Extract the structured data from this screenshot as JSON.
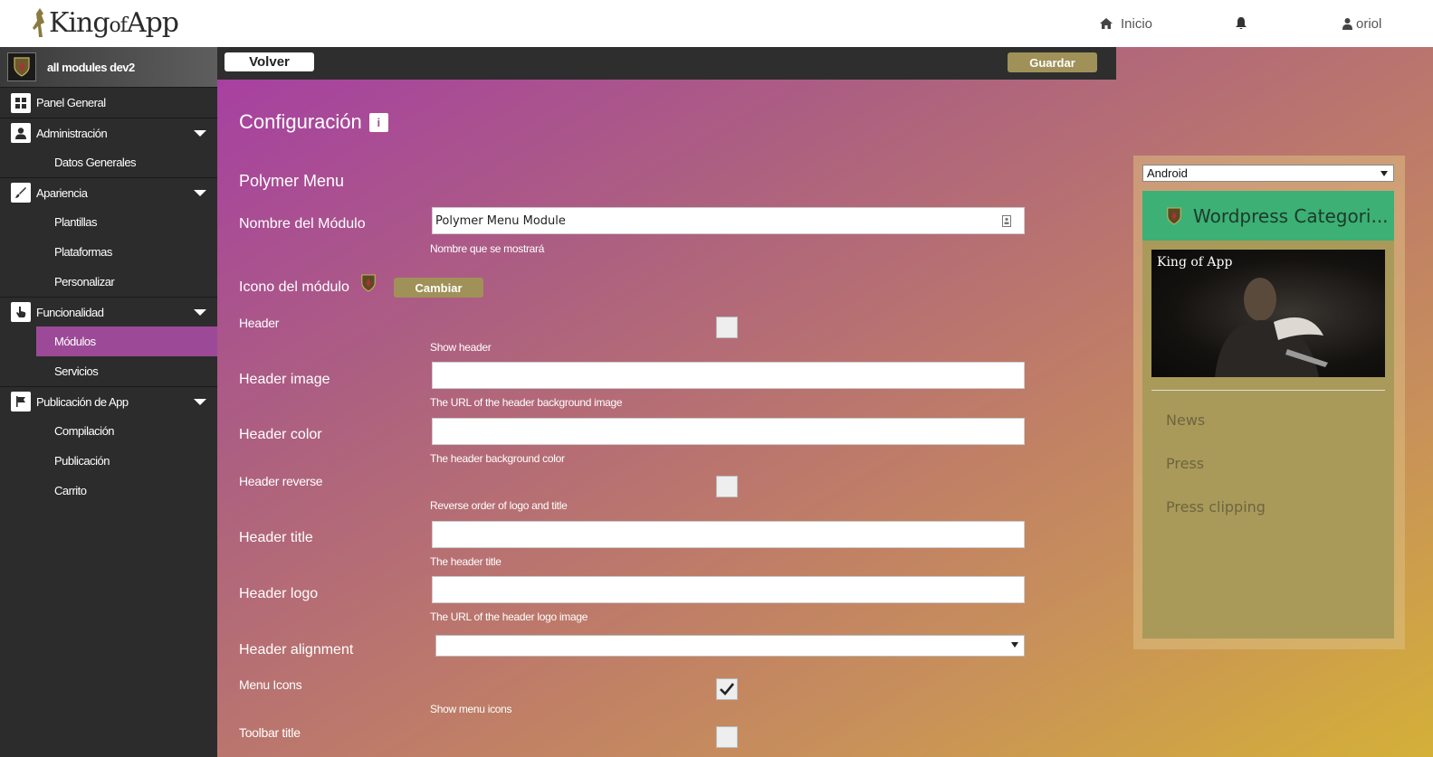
{
  "header": {
    "logo_text_1": "King",
    "logo_text_2": "of",
    "logo_text_3": "App",
    "home_label": "Inicio",
    "user_label": "oriol"
  },
  "sidebar": {
    "app_name": "all modules dev2",
    "items": [
      {
        "label": "Panel General"
      },
      {
        "label": "Administración"
      },
      {
        "label": "Datos Generales"
      },
      {
        "label": "Apariencia"
      },
      {
        "label": "Plantillas"
      },
      {
        "label": "Plataformas"
      },
      {
        "label": "Personalizar"
      },
      {
        "label": "Funcionalidad"
      },
      {
        "label": "Módulos"
      },
      {
        "label": "Servicios"
      },
      {
        "label": "Publicación de App"
      },
      {
        "label": "Compilación"
      },
      {
        "label": "Publicación"
      },
      {
        "label": "Carrito"
      }
    ]
  },
  "toolbar": {
    "back_label": "Volver",
    "save_label": "Guardar"
  },
  "config": {
    "title": "Configuración",
    "info_icon": "i",
    "module_title": "Polymer Menu",
    "name_label": "Nombre del Módulo",
    "name_value": "Polymer Menu Module",
    "name_help": "Nombre que se mostrará",
    "icon_label": "Icono del módulo",
    "change_label": "Cambiar",
    "fields": {
      "header_label": "Header",
      "header_help": "Show header",
      "header_checked": false,
      "header_image_label": "Header image",
      "header_image_value": "",
      "header_image_help": "The URL of the header background image",
      "header_color_label": "Header color",
      "header_color_value": "",
      "header_color_help": "The header background color",
      "header_reverse_label": "Header reverse",
      "header_reverse_help": "Reverse order of logo and title",
      "header_reverse_checked": false,
      "header_title_label": "Header title",
      "header_title_value": "",
      "header_title_help": "The header title",
      "header_logo_label": "Header logo",
      "header_logo_value": "",
      "header_logo_help": "The URL of the header logo image",
      "header_alignment_label": "Header alignment",
      "header_alignment_value": "",
      "menu_icons_label": "Menu Icons",
      "menu_icons_help": "Show menu icons",
      "menu_icons_checked": true,
      "toolbar_title_label": "Toolbar title",
      "toolbar_title_checked": false
    }
  },
  "preview": {
    "platform": "Android",
    "header_title": "Wordpress Categori...",
    "image_logo": "King of App",
    "menu_items": [
      "News",
      "Press",
      "Press clipping"
    ]
  },
  "colors": {
    "accent_active": "#9c4a98",
    "button_gold": "#a09158",
    "preview_header": "#3cb075"
  }
}
